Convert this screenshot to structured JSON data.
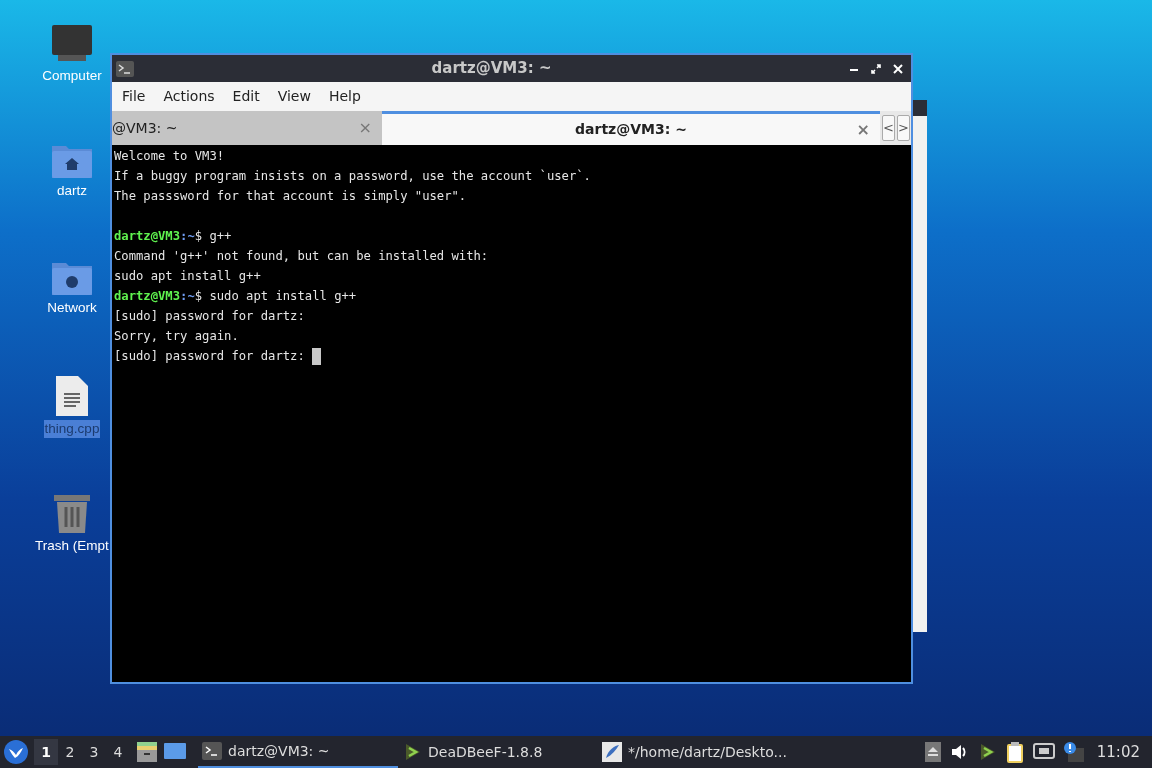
{
  "desktop_icons": [
    {
      "kind": "computer",
      "label": "Computer",
      "selected": false
    },
    {
      "kind": "home",
      "label": "dartz",
      "selected": false
    },
    {
      "kind": "network",
      "label": "Network",
      "selected": false
    },
    {
      "kind": "file",
      "label": "thing.cpp",
      "selected": true
    },
    {
      "kind": "trash",
      "label": "Trash (Empt",
      "selected": false
    }
  ],
  "window": {
    "title": "dartz@VM3: ~",
    "menu": [
      "File",
      "Actions",
      "Edit",
      "View",
      "Help"
    ],
    "tabs": [
      {
        "label": "@VM3: ~",
        "close": "×",
        "selected": false
      },
      {
        "label": "dartz@VM3: ~",
        "close": "×",
        "selected": true
      }
    ],
    "tab_scroll": [
      "<",
      ">"
    ],
    "terminal": {
      "cursor": true,
      "lines": [
        {
          "kind": "output",
          "text": "Welcome to VM3!"
        },
        {
          "kind": "output",
          "text": "If a buggy program insists on a password, use the account `user`."
        },
        {
          "kind": "output",
          "text": "The passsword for that account is simply \"user\"."
        },
        {
          "kind": "blank"
        },
        {
          "kind": "prompt",
          "user": "dartz@VM3",
          "path": ":~",
          "command": "$ g++"
        },
        {
          "kind": "output",
          "text": "Command 'g++' not found, but can be installed with:"
        },
        {
          "kind": "output",
          "text": "sudo apt install g++"
        },
        {
          "kind": "prompt",
          "user": "dartz@VM3",
          "path": ":~",
          "command": "$ sudo apt install g++"
        },
        {
          "kind": "output",
          "text": "[sudo] password for dartz:"
        },
        {
          "kind": "output",
          "text": "Sorry, try again."
        },
        {
          "kind": "output",
          "text": "[sudo] password for dartz: "
        }
      ]
    }
  },
  "taskbar": {
    "workspaces": [
      {
        "label": "1",
        "selected": true
      },
      {
        "label": "2",
        "selected": false
      },
      {
        "label": "3",
        "selected": false
      },
      {
        "label": "4",
        "selected": false
      }
    ],
    "tasks": [
      {
        "kind": "terminal",
        "label": "dartz@VM3: ~",
        "selected": true
      },
      {
        "kind": "player",
        "label": "DeaDBeeF-1.8.8",
        "selected": false
      },
      {
        "kind": "editor",
        "label": "*/home/dartz/Deskto...",
        "selected": false
      }
    ],
    "clock": "11:02"
  }
}
